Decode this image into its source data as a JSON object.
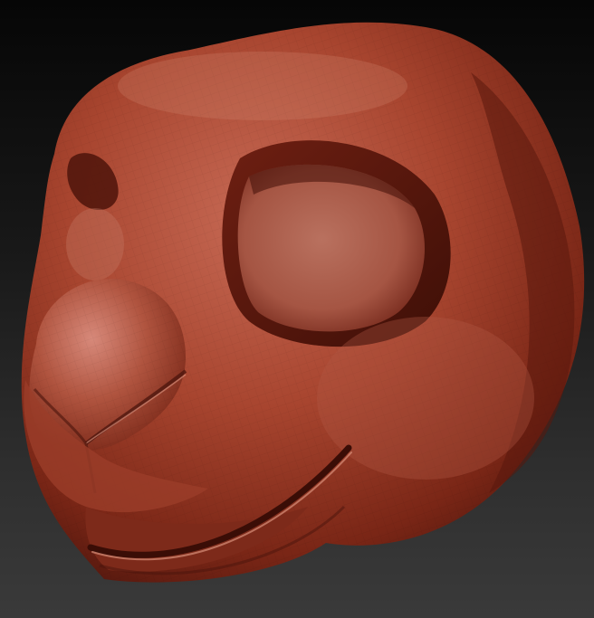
{
  "scene": {
    "subject": "sculpted-animal-head",
    "material_color": "#a8452f",
    "highlight_color": "#d98a73",
    "shadow_color": "#4a140c",
    "background_top": "#060606",
    "background_bottom": "#3a3a3a"
  }
}
